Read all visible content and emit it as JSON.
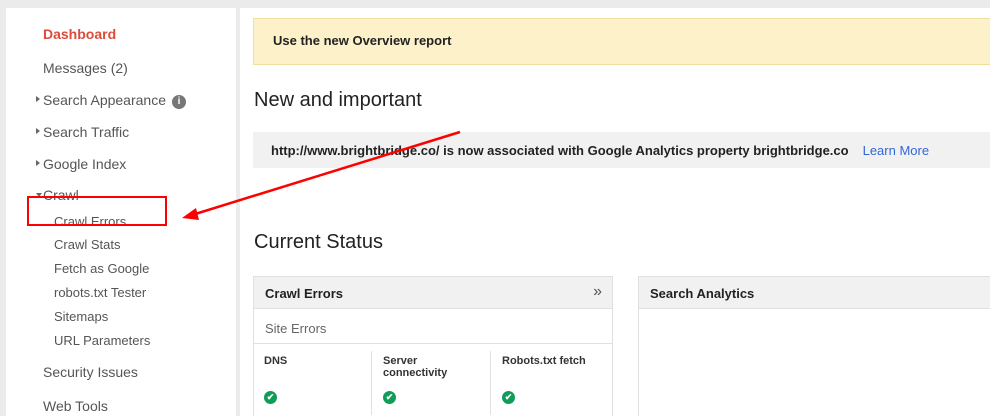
{
  "sidebar": {
    "dashboard": "Dashboard",
    "messages": "Messages (2)",
    "search_appearance": "Search Appearance",
    "info_icon": "i",
    "search_traffic": "Search Traffic",
    "google_index": "Google Index",
    "crawl": "Crawl",
    "crawl_items": [
      "Crawl Errors",
      "Crawl Stats",
      "Fetch as Google",
      "robots.txt Tester",
      "Sitemaps",
      "URL Parameters"
    ],
    "security_issues": "Security Issues",
    "web_tools": "Web Tools"
  },
  "banner": {
    "text": "Use the new Overview report"
  },
  "new_important": {
    "heading": "New and important",
    "notice": "http://www.brightbridge.co/ is now associated with Google Analytics property brightbridge.co",
    "learn_more": "Learn More"
  },
  "current_status": {
    "heading": "Current Status",
    "crawl_errors_panel": {
      "title": "Crawl Errors",
      "expand_icon": "»",
      "site_errors": "Site Errors",
      "columns": [
        {
          "label": "DNS",
          "status_icon": "✔"
        },
        {
          "label": "Server connectivity",
          "status_icon": "✔"
        },
        {
          "label": "Robots.txt fetch",
          "status_icon": "✔"
        }
      ]
    },
    "search_analytics_panel": {
      "title": "Search Analytics"
    }
  },
  "colors": {
    "accent_red": "#dd4b39",
    "banner_bg": "#fcf1c8",
    "link_blue": "#3367d6",
    "annotation_red": "#ff0000",
    "status_green": "#0f9d58"
  }
}
